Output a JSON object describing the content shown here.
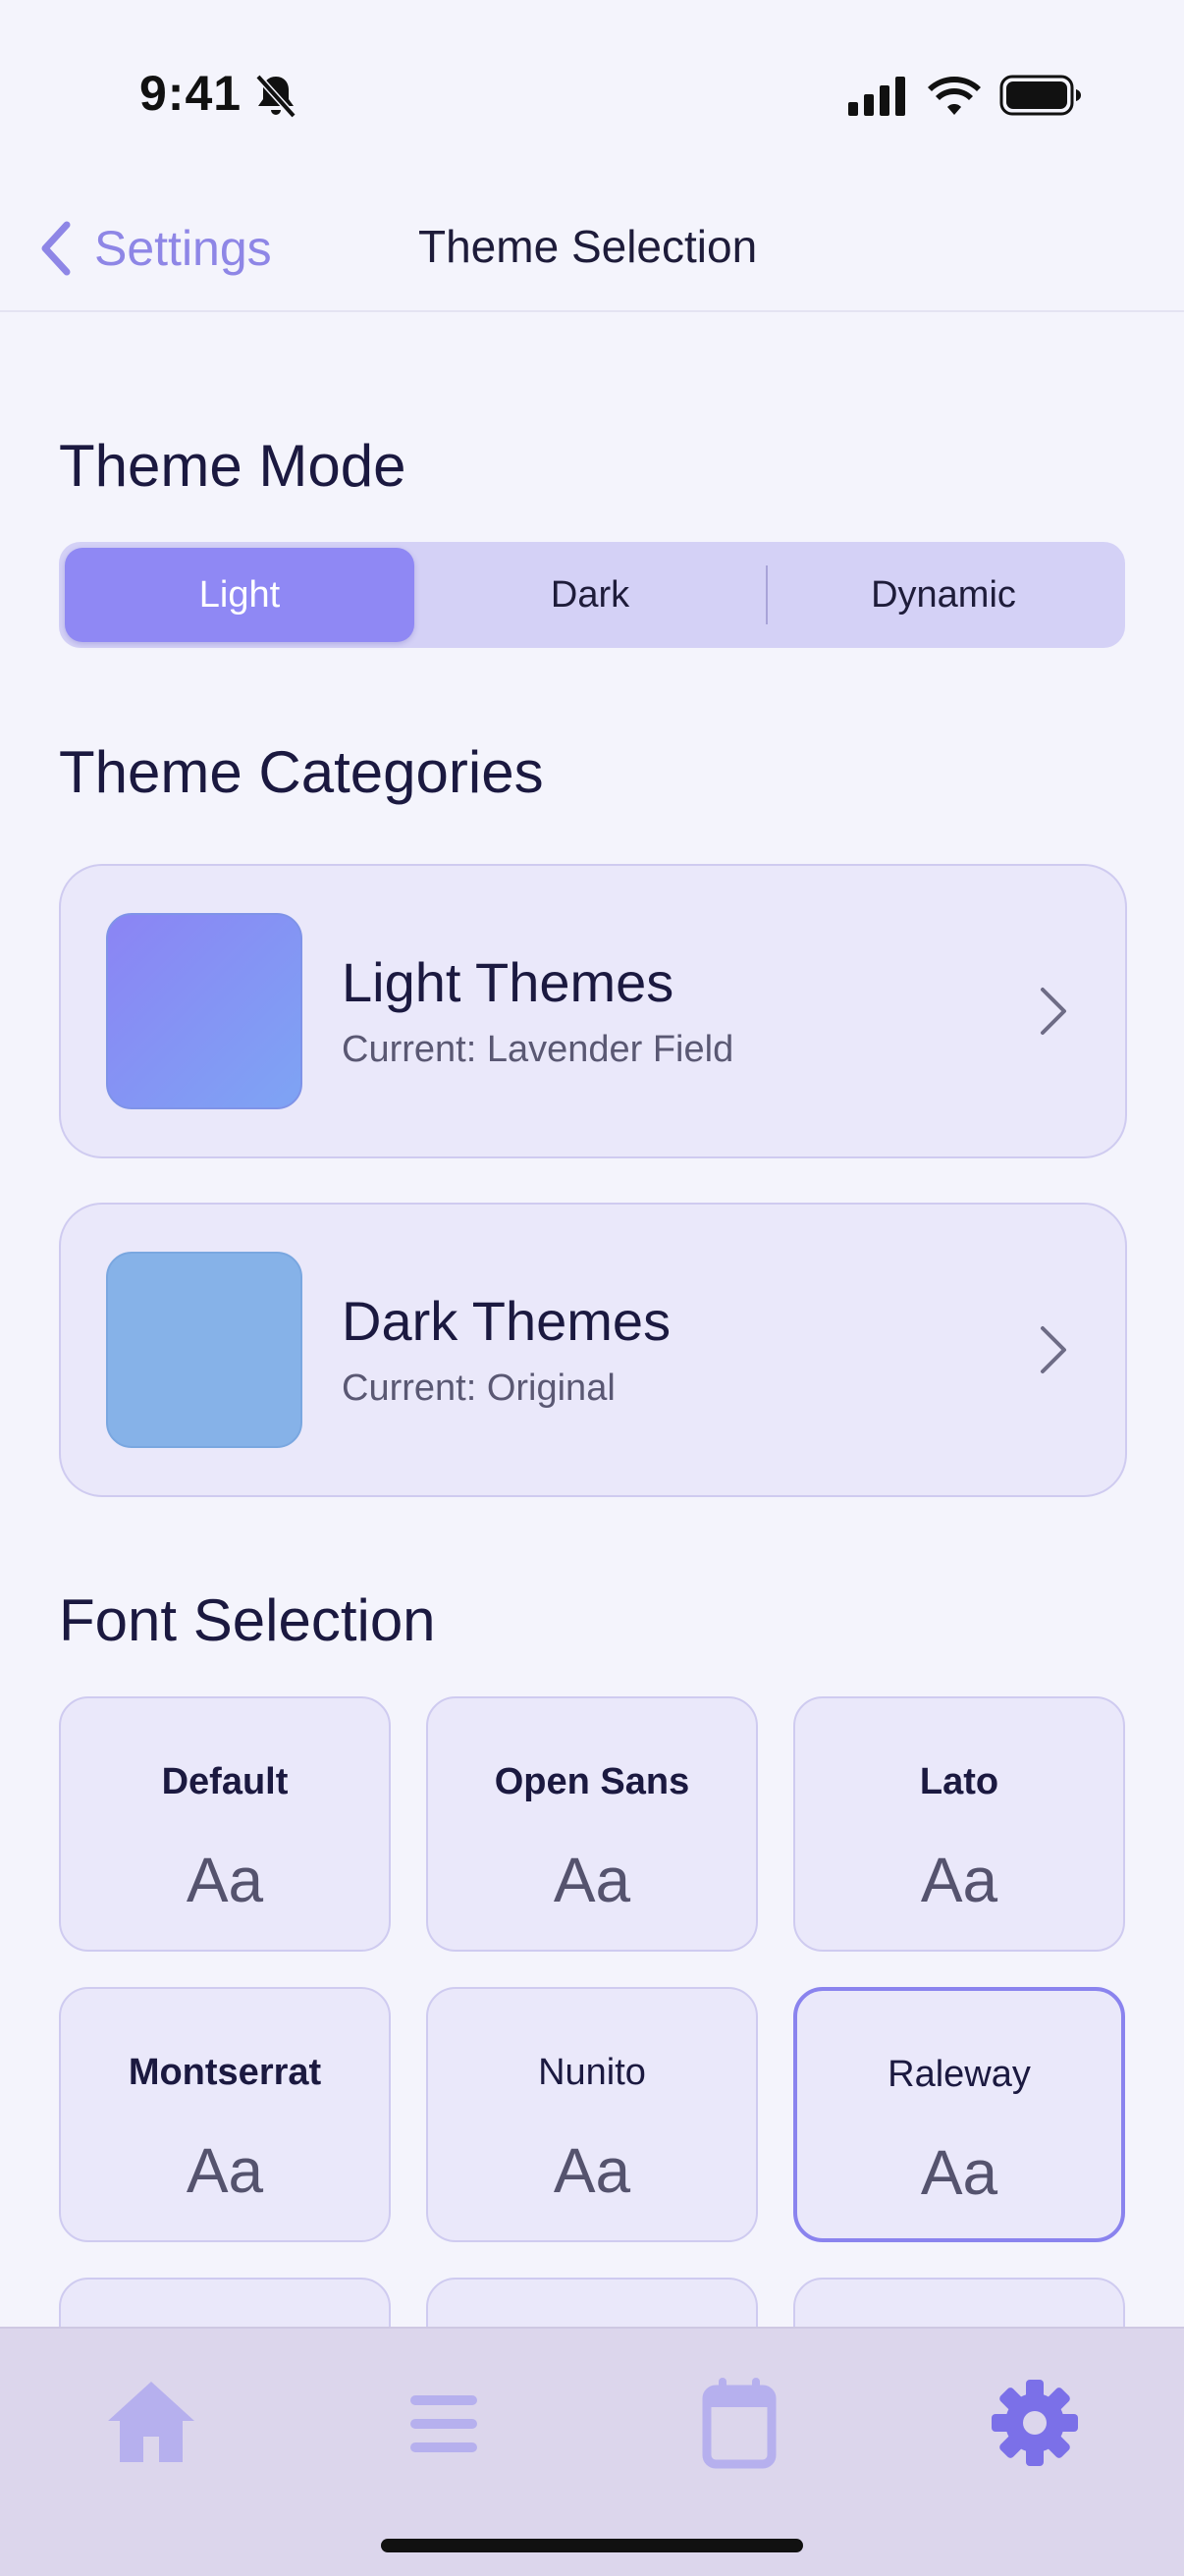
{
  "status_bar": {
    "time": "9:41"
  },
  "nav": {
    "back_label": "Settings",
    "title": "Theme Selection"
  },
  "theme_mode": {
    "title": "Theme Mode",
    "options": [
      "Light",
      "Dark",
      "Dynamic"
    ],
    "selected": "Light"
  },
  "theme_categories": {
    "title": "Theme Categories",
    "items": [
      {
        "name": "Light Themes",
        "current": "Current: Lavender Field"
      },
      {
        "name": "Dark Themes",
        "current": "Current: Original"
      }
    ]
  },
  "font_selection": {
    "title": "Font Selection",
    "fonts": [
      {
        "name": "Default",
        "sample": "Aa"
      },
      {
        "name": "Open Sans",
        "sample": "Aa"
      },
      {
        "name": "Lato",
        "sample": "Aa"
      },
      {
        "name": "Montserrat",
        "sample": "Aa"
      },
      {
        "name": "Nunito",
        "sample": "Aa"
      },
      {
        "name": "Raleway",
        "sample": "Aa"
      }
    ],
    "selected": "Raleway"
  },
  "tab_bar": {
    "items": [
      "home-icon",
      "list-icon",
      "calendar-icon",
      "settings-gear-icon"
    ],
    "active": "settings-gear-icon"
  },
  "colors": {
    "accent": "#8F88F4",
    "light_swatch_from": "#8B84F4",
    "light_swatch_to": "#7EA4F4",
    "dark_swatch": "#86B2E8",
    "tab_active": "#7B70E8",
    "tab_inactive": "#B6B0EE"
  }
}
